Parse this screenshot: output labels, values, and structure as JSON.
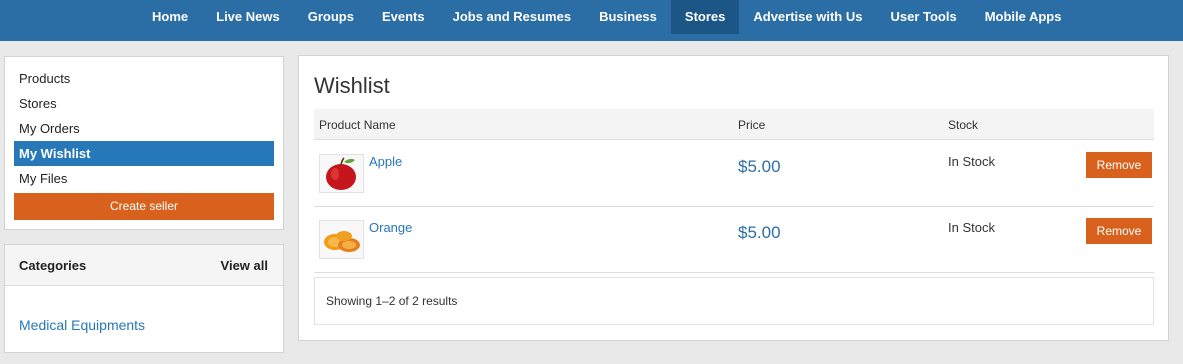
{
  "nav": {
    "items": [
      "Home",
      "Live News",
      "Groups",
      "Events",
      "Jobs and Resumes",
      "Business",
      "Stores",
      "Advertise with Us",
      "User Tools",
      "Mobile Apps"
    ],
    "active": "Stores"
  },
  "account_menu": {
    "items": [
      "Products",
      "Stores",
      "My Orders",
      "My Wishlist",
      "My Files"
    ],
    "active": "My Wishlist",
    "create_seller_label": "Create seller"
  },
  "categories": {
    "title": "Categories",
    "view_all": "View all",
    "items": [
      "Medical Equipments"
    ]
  },
  "wishlist": {
    "title": "Wishlist",
    "columns": {
      "product": "Product Name",
      "price": "Price",
      "stock": "Stock"
    },
    "rows": [
      {
        "name": "Apple",
        "price": "$5.00",
        "stock": "In Stock",
        "action": "Remove",
        "thumb_icon": "apple-image"
      },
      {
        "name": "Orange",
        "price": "$5.00",
        "stock": "In Stock",
        "action": "Remove",
        "thumb_icon": "orange-slices-image"
      }
    ],
    "results_text": "Showing 1–2 of 2 results"
  },
  "colors": {
    "nav_bg": "#2b6ea6",
    "nav_active": "#1c5686",
    "accent_orange": "#d9611e",
    "link_blue": "#2778b9"
  }
}
